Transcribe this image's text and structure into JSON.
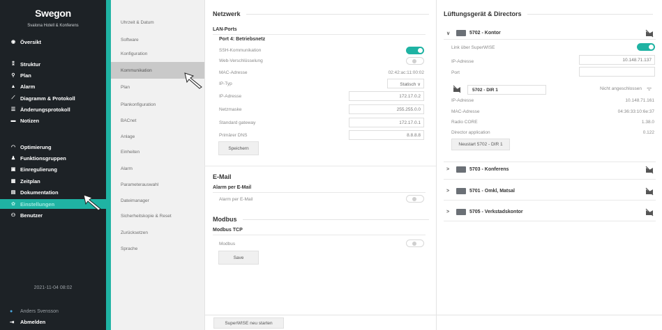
{
  "sidebar": {
    "brand": "Swegon",
    "brand_sub": "Svalona Hotell & Konferens",
    "items": [
      {
        "label": "Översikt",
        "icon": "eye-icon",
        "glyph": "◉"
      },
      {
        "label": "Struktur",
        "icon": "structure-icon",
        "glyph": "⁑"
      },
      {
        "label": "Plan",
        "icon": "location-pin-icon",
        "glyph": "⚲"
      },
      {
        "label": "Alarm",
        "icon": "bell-icon",
        "glyph": "▲"
      },
      {
        "label": "Diagramm & Protokoll",
        "icon": "chart-line-icon",
        "glyph": "⟋"
      },
      {
        "label": "Änderungsprotokoll",
        "icon": "list-icon",
        "glyph": "☰"
      },
      {
        "label": "Notizen",
        "icon": "note-icon",
        "glyph": "▬"
      },
      {
        "label": "Optimierung",
        "icon": "gauge-icon",
        "glyph": "◠"
      },
      {
        "label": "Funktionsgruppen",
        "icon": "group-icon",
        "glyph": "♟"
      },
      {
        "label": "Einregulierung",
        "icon": "adjust-icon",
        "glyph": "▣"
      },
      {
        "label": "Zeitplan",
        "icon": "calendar-icon",
        "glyph": "▦"
      },
      {
        "label": "Dokumentation",
        "icon": "document-icon",
        "glyph": "▤"
      },
      {
        "label": "Einstellungen",
        "icon": "gear-icon",
        "glyph": "✿"
      },
      {
        "label": "Benutzer",
        "icon": "users-icon",
        "glyph": "⚇"
      }
    ],
    "datetime": "2021-11-04 08:02",
    "user": "Anders Svensson",
    "logout": "Abmelden"
  },
  "submenu": {
    "items": [
      "Uhrzeit & Datum",
      "Software",
      "Konfiguration",
      "Kommunikation",
      "Plan",
      "Plankonfiguration",
      "BACnet",
      "Anlage",
      "Einheiten",
      "Alarm",
      "Parameterauswahl",
      "Dateimanager",
      "Sicherheitskopie & Reset",
      "Zurücksetzen",
      "Sprache"
    ],
    "active": "Kommunikation"
  },
  "netzwerk": {
    "title": "Netzwerk",
    "lan_ports": "LAN-Ports",
    "port4": "Port 4: Betriebsnetz",
    "ssh_label": "SSH-Kommunikation",
    "ssh_on": true,
    "web_label": "Web-Verschlüsselung",
    "web_on": false,
    "mac_label": "MAC-Adresse",
    "mac_value": "02:42:ac:11:00:02",
    "iptype_label": "IP-Typ",
    "iptype_value": "Statisch",
    "ip_label": "IP-Adresse",
    "ip_value": "172.17.0.2",
    "mask_label": "Netzmaske",
    "mask_value": "255.255.0.0",
    "gateway_label": "Standard gateway",
    "gateway_value": "172.17.0.1",
    "dns_label": "Primärer DNS",
    "dns_value": "8.8.8.8",
    "save_label": "Speichern"
  },
  "email": {
    "title": "E-Mail",
    "sub": "Alarm per E-Mail",
    "label": "Alarm per E-Mail",
    "on": false
  },
  "modbus": {
    "title": "Modbus",
    "sub": "Modbus TCP",
    "label": "Modbus",
    "on": false,
    "save_label": "Save"
  },
  "restart_button": "SuperWISE neu starten",
  "lueftung": {
    "title": "Lüftungsgerät & Directors",
    "device1": {
      "name": "5702 - Kontor",
      "link_label": "Link über SuperWISE",
      "link_on": true,
      "ip_label": "IP-Adresse",
      "ip_value": "10.148.71.137",
      "port_label": "Port",
      "port_value": "",
      "dir_name": "5702 - DIR 1",
      "dir_status": "Nicht angeschlossen",
      "dir_ip_label": "IP-Adresse",
      "dir_ip_value": "10.148.71.161",
      "dir_mac_label": "MAC-Adresse",
      "dir_mac_value": "04:36:33:10:6e:37",
      "radio_label": "Radio CORE",
      "radio_value": "1.38.0",
      "app_label": "Director application",
      "app_value": "0.122",
      "restart_label": "Neustart 5702 - DIR 1"
    },
    "others": [
      "5703 - Konferens",
      "5701 - Omkl, Matsal",
      "5705 - Verkstadskontor"
    ]
  }
}
